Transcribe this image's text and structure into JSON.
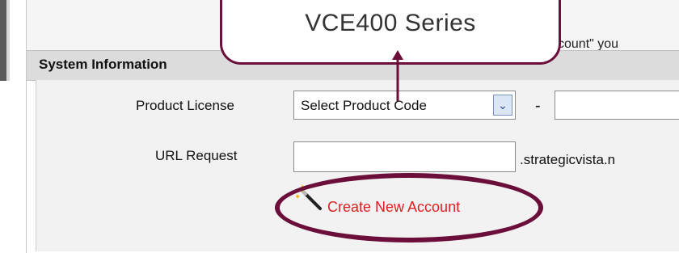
{
  "callout": {
    "label": "VCE400 Series"
  },
  "notice": {
    "text": "ccount\" you"
  },
  "section": {
    "title": "System Information"
  },
  "form": {
    "product_license_label": "Product License",
    "product_code_select": "Select Product Code",
    "select_arrow": "⌄",
    "dash": "-",
    "url_request_label": "URL Request",
    "url_suffix": ".strategicvista.n"
  },
  "actions": {
    "create_account_label": "Create New Account"
  },
  "colors": {
    "annotation": "#6b0e3a",
    "link": "#e02020",
    "section_bg": "#dcdcdc"
  }
}
